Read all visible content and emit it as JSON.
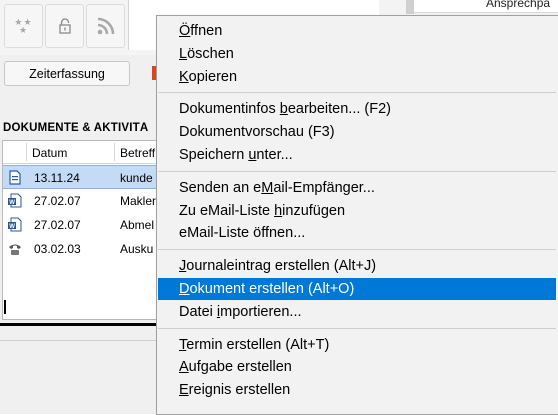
{
  "toolbar": {
    "buttons": [
      {
        "icon": "stars-icon",
        "glyph": "★★\n★"
      },
      {
        "icon": "lock-icon"
      },
      {
        "icon": "rss-icon"
      }
    ]
  },
  "right_header": {
    "label": "Ansprechpa"
  },
  "zeit_button": {
    "label": "Zeiterfassung"
  },
  "section": {
    "title": "DOKUMENTE & AKTIVITÄ"
  },
  "table": {
    "columns": [
      "Datum",
      "Betreff"
    ],
    "rows": [
      {
        "icon": "document-icon",
        "date": "13.11.24",
        "subject": "kunde",
        "selected": true
      },
      {
        "icon": "word-document-icon",
        "date": "27.02.07",
        "subject": "Makler",
        "selected": false
      },
      {
        "icon": "word-document-icon",
        "date": "27.02.07",
        "subject": "Abmel",
        "selected": false
      },
      {
        "icon": "phone-icon",
        "date": "03.02.03",
        "subject": "Ausku",
        "selected": false
      }
    ]
  },
  "context_menu": {
    "groups": [
      [
        {
          "pre": "",
          "ul": "Ö",
          "post": "ffnen"
        },
        {
          "pre": "",
          "ul": "L",
          "post": "öschen"
        },
        {
          "pre": "",
          "ul": "K",
          "post": "opieren"
        }
      ],
      [
        {
          "pre": "Dokumentinfos ",
          "ul": "b",
          "post": "earbeiten... (F2)"
        },
        {
          "pre": "Dokumentvorschau (F3)",
          "ul": "",
          "post": ""
        },
        {
          "pre": "Speichern ",
          "ul": "u",
          "post": "nter..."
        }
      ],
      [
        {
          "pre": "Senden an e",
          "ul": "M",
          "post": "ail-Empfänger..."
        },
        {
          "pre": "Zu eMail-Liste ",
          "ul": "h",
          "post": "inzufügen"
        },
        {
          "pre": "eMail-Liste öffnen...",
          "ul": "",
          "post": ""
        }
      ],
      [
        {
          "pre": "",
          "ul": "J",
          "post": "ournaleintrag erstellen (Alt+J)"
        },
        {
          "pre": "",
          "ul": "D",
          "post": "okument erstellen (Alt+O)",
          "highlighted": true
        },
        {
          "pre": "Datei ",
          "ul": "i",
          "post": "mportieren..."
        }
      ],
      [
        {
          "pre": "",
          "ul": "T",
          "post": "ermin erstellen (Alt+T)"
        },
        {
          "pre": "",
          "ul": "A",
          "post": "ufgabe erstellen"
        },
        {
          "pre": "",
          "ul": "E",
          "post": "reignis erstellen"
        }
      ]
    ]
  },
  "colors": {
    "highlight": "#0078d7",
    "selection_row": "#c3dbf4",
    "menu_bg": "#f2f2f2"
  }
}
